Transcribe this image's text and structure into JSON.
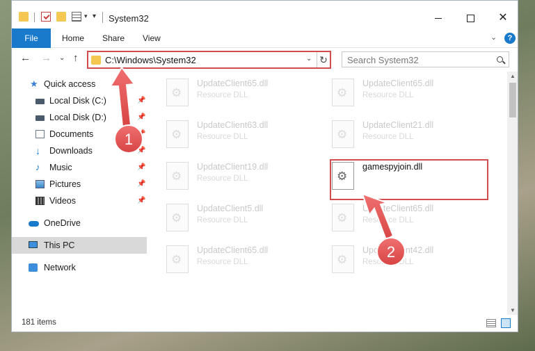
{
  "window": {
    "title": "System32"
  },
  "ribbon": {
    "tabs": [
      "File",
      "Home",
      "Share",
      "View"
    ],
    "help_label": "?"
  },
  "address": {
    "path": "C:\\Windows\\System32",
    "refresh_glyph": "↻",
    "dropdown_glyph": "⌄"
  },
  "search": {
    "placeholder": "Search System32"
  },
  "nav": {
    "back": "←",
    "forward": "→",
    "recent": "⌄",
    "up": "↑",
    "items": [
      {
        "label": "Quick access",
        "icon": "star-icon",
        "pinned": false
      },
      {
        "label": "Local Disk (C:)",
        "icon": "disk-icon",
        "pinned": true
      },
      {
        "label": "Local Disk (D:)",
        "icon": "disk-icon",
        "pinned": true
      },
      {
        "label": "Documents",
        "icon": "documents-icon",
        "pinned": true
      },
      {
        "label": "Downloads",
        "icon": "downloads-icon",
        "pinned": true
      },
      {
        "label": "Music",
        "icon": "music-icon",
        "pinned": true
      },
      {
        "label": "Pictures",
        "icon": "pictures-icon",
        "pinned": true
      },
      {
        "label": "Videos",
        "icon": "videos-icon",
        "pinned": true
      },
      {
        "label": "OneDrive",
        "icon": "onedrive-icon",
        "pinned": false
      },
      {
        "label": "This PC",
        "icon": "this-pc-icon",
        "pinned": false,
        "selected": true
      },
      {
        "label": "Network",
        "icon": "network-icon",
        "pinned": false
      }
    ]
  },
  "files": [
    {
      "name": "UpdateClient65.dll",
      "type": "Resource DLL"
    },
    {
      "name": "UpdateClient65.dll",
      "type": "Resource DLL"
    },
    {
      "name": "UpdateClient63.dll",
      "type": "Resource DLL"
    },
    {
      "name": "UpdateClient21.dll",
      "type": "Resource DLL"
    },
    {
      "name": "UpdateClient19.dll",
      "type": "Resource DLL"
    },
    {
      "name": "gamespyjoin.dll",
      "type": ""
    },
    {
      "name": "UpdateClient5.dll",
      "type": "Resource DLL"
    },
    {
      "name": "UpdateClient65.dll",
      "type": "Resource DLL"
    },
    {
      "name": "UpdateClient65.dll",
      "type": "Resource DLL"
    },
    {
      "name": "UpdateClient42.dll",
      "type": "Resource DLL"
    }
  ],
  "status": {
    "item_count": "181 items"
  },
  "annotations": {
    "step1": "1",
    "step2": "2",
    "color": "#e05a5a"
  }
}
